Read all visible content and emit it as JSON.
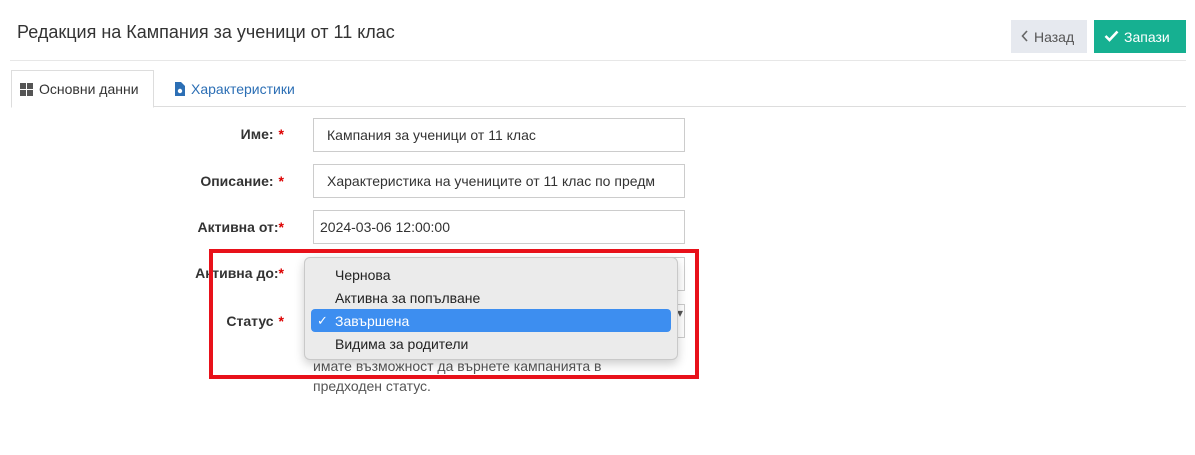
{
  "header": {
    "title": "Редакция на Кампания за ученици от 11 клас",
    "back_label": "Назад",
    "save_label": "Запази"
  },
  "tabs": [
    {
      "label": "Основни данни",
      "active": true
    },
    {
      "label": "Характеристики",
      "active": false
    }
  ],
  "form": {
    "required_marker": "*",
    "name": {
      "label": "Име:",
      "value": "Кампания за ученици от 11 клас"
    },
    "description": {
      "label": "Описание:",
      "value": "Характеристика на учениците от 11 клас по предм"
    },
    "active_from": {
      "label": "Активна от:",
      "value": "2024-03-06 12:00:00"
    },
    "active_to": {
      "label": "Активна до:"
    },
    "status": {
      "label": "Статус",
      "selected": "Завършена",
      "options": [
        "Чернова",
        "Активна за попълване",
        "Завършена",
        "Видима за родители"
      ],
      "help_text": "имате възможност да върнете кампанията в предходен статус."
    }
  },
  "colors": {
    "save_button": "#16b091",
    "back_button": "#e6e9ef",
    "link": "#2c6fb5",
    "required": "#d00000",
    "selected_option": "#3d8ef0",
    "highlight_frame": "#e8111a"
  }
}
